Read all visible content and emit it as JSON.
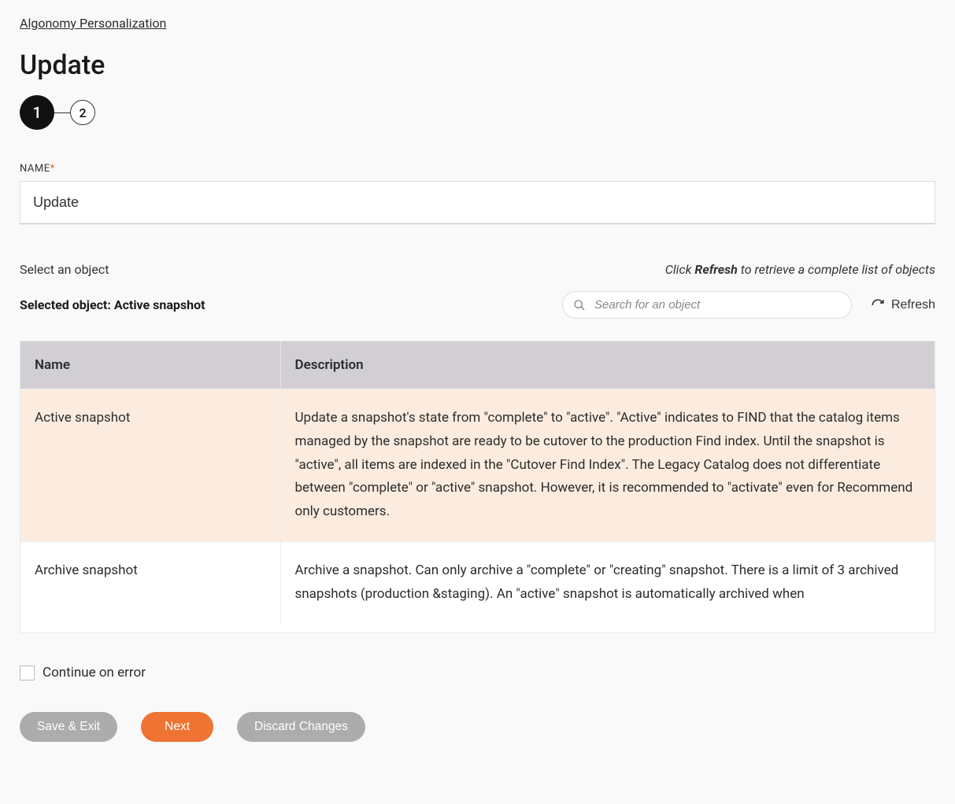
{
  "breadcrumb": "Algonomy Personalization",
  "page_title": "Update",
  "stepper": {
    "steps": [
      "1",
      "2"
    ],
    "active_index": 0
  },
  "name_field": {
    "label": "NAME",
    "required_marker": "*",
    "value": "Update"
  },
  "select_section": {
    "label": "Select an object",
    "hint_prefix": "Click ",
    "hint_strong": "Refresh",
    "hint_suffix": " to retrieve a complete list of objects",
    "selected_prefix": "Selected object: ",
    "selected_value": "Active snapshot",
    "search_placeholder": "Search for an object",
    "refresh_label": "Refresh"
  },
  "table": {
    "columns": [
      "Name",
      "Description"
    ],
    "rows": [
      {
        "name": "Active snapshot",
        "description": "Update a snapshot's state from \"complete\" to \"active\". \"Active\" indicates to FIND that the catalog items managed by the snapshot are ready to be cutover to the production Find index. Until the snapshot is \"active\", all items are indexed in the \"Cutover Find Index\". The Legacy Catalog does not differentiate between \"complete\" or \"active\" snapshot. However, it is recommended to \"activate\" even for Recommend only customers.",
        "selected": true
      },
      {
        "name": "Archive snapshot",
        "description": "Archive a snapshot. Can only archive a \"complete\" or \"creating\" snapshot. There is a limit of 3 archived snapshots (production &staging). An \"active\" snapshot is automatically archived when",
        "selected": false
      }
    ]
  },
  "continue_on_error": {
    "label": "Continue on error",
    "checked": false
  },
  "buttons": {
    "save_exit": "Save & Exit",
    "next": "Next",
    "discard": "Discard Changes"
  }
}
